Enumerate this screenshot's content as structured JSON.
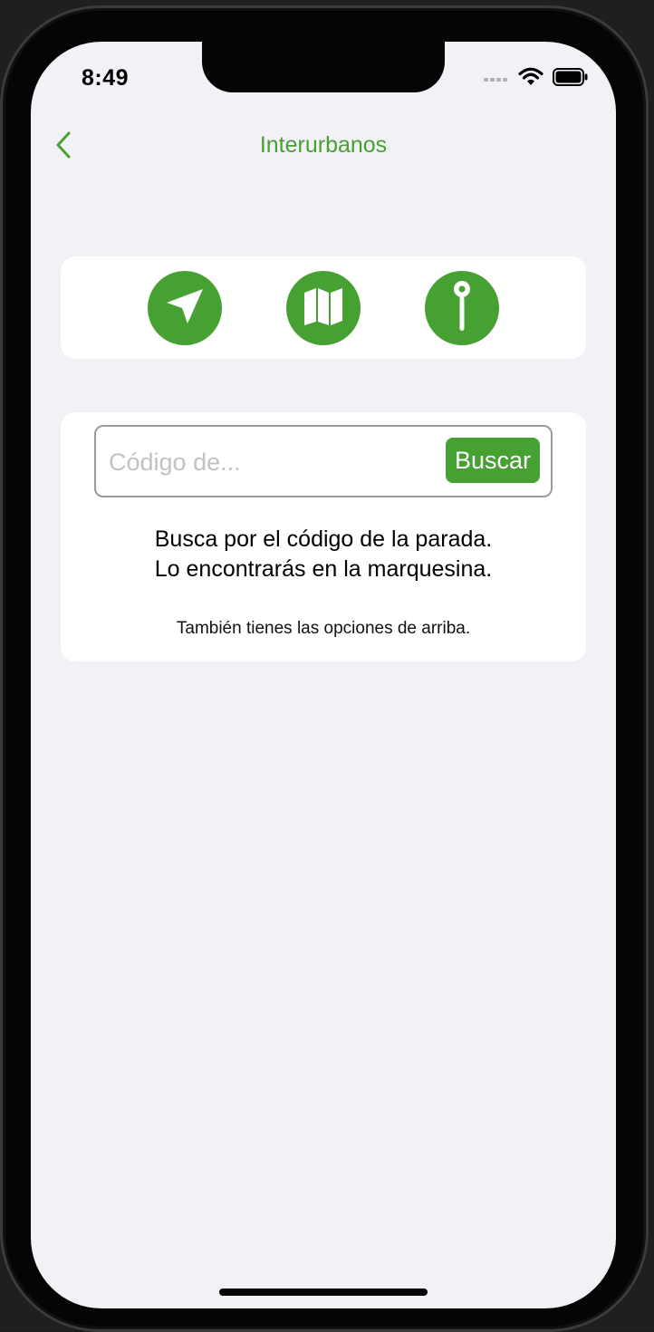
{
  "status_bar": {
    "time": "8:49",
    "icons": [
      "cellular-signal-icon",
      "wifi-icon",
      "battery-icon"
    ]
  },
  "nav": {
    "back_icon": "chevron-left-icon",
    "title": "Interurbanos"
  },
  "actions": [
    {
      "name": "location-arrow-icon"
    },
    {
      "name": "map-icon"
    },
    {
      "name": "pin-icon"
    }
  ],
  "search": {
    "placeholder": "Código de...",
    "value": "",
    "button_label": "Buscar"
  },
  "hint": {
    "line1": "Busca por el código de la parada.",
    "line2": "Lo encontrarás en la marquesina.",
    "secondary": "También tienes las opciones de arriba."
  },
  "colors": {
    "accent": "#47a032",
    "background": "#f1f1f6",
    "card": "#ffffff"
  }
}
